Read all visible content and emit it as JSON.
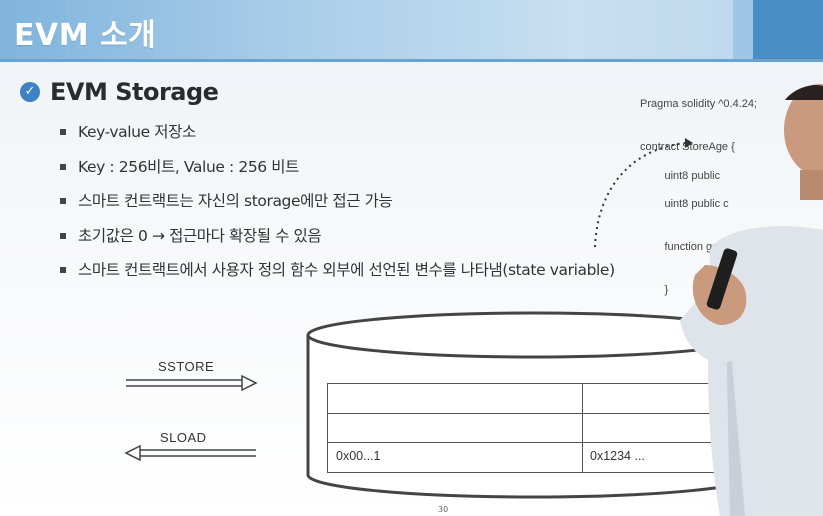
{
  "header": {
    "title": "EVM 소개"
  },
  "section": {
    "title": "EVM Storage"
  },
  "bullets": [
    "Key-value 저장소",
    "Key : 256비트, Value : 256 비트",
    "스마트 컨트랙트는 자신의 storage에만 접근 가능",
    "초기값은 0 → 접근마다 확장될 수 있음",
    "스마트 컨트랙트에서 사용자 정의 함수 외부에 선언된 변수를 나타냄(state variable)"
  ],
  "code": {
    "lines": [
      "Pragma solidity ^0.4.24;",
      "",
      "contract StoreAge {",
      "        uint8 public",
      "        uint8 public c",
      "",
      "        function getA",
      "",
      "        }",
      "}"
    ]
  },
  "diagram": {
    "sstore_label": "SSTORE",
    "sload_label": "SLOAD",
    "key_cell": "0x00...1",
    "value_cell": "0x1234 ..."
  },
  "footer": {
    "page_number": "30"
  },
  "colors": {
    "header_blue": "#7fb4dd",
    "check_blue": "#3d82c4",
    "text_dark": "#333333"
  }
}
